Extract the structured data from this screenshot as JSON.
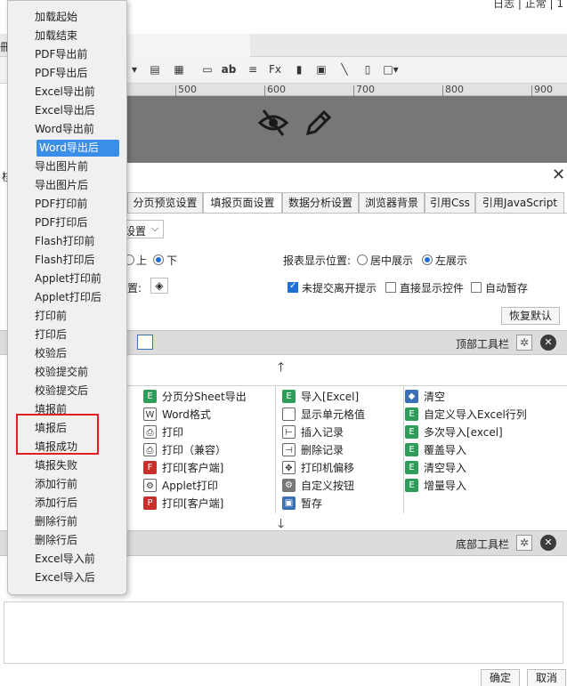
{
  "app": {
    "status_text": "日志 | 正常 | 1",
    "tab_partial": "冊"
  },
  "ruler": {
    "labels": [
      "500",
      "600",
      "700",
      "800",
      "900"
    ]
  },
  "dialog": {
    "tabs": [
      "分页预览设置",
      "填报页面设置",
      "数据分析设置",
      "浏览器背景",
      "引用Css",
      "引用JavaScript"
    ],
    "active_tab": "填报页面设置",
    "partial_tab_char": "核",
    "settings": {
      "dropdown_value": "设置",
      "position_label_partial": "置:",
      "radio_top": "上",
      "radio_bottom": "下",
      "display_position_label": "报表显示位置:",
      "center_display": "居中展示",
      "left_display": "左展示",
      "unsubmitted_prompt": "未提交离开提示",
      "direct_show_controls": "直接显示控件",
      "auto_save": "自动暂存",
      "restore_default": "恢复默认"
    },
    "top_toolbar_label": "顶部工具栏",
    "bottom_toolbar_label": "底部工具栏",
    "buttons": {
      "col1": [
        "分页分Sheet导出",
        "Word格式",
        "打印",
        "打印（兼容）",
        "打印[客户端]",
        "Applet打印",
        "打印[客户端]"
      ],
      "col2": [
        "导入[Excel]",
        "显示单元格值",
        "插入记录",
        "删除记录",
        "打印机偏移",
        "自定义按钮",
        "暂存"
      ],
      "col3": [
        "清空",
        "自定义导入Excel行列",
        "多次导入[excel]",
        "覆盖导入",
        "清空导入",
        "增量导入"
      ]
    },
    "ok": "确定",
    "cancel": "取消"
  },
  "menu": {
    "items": [
      "加载起始",
      "加载结束",
      "PDF导出前",
      "PDF导出后",
      "Excel导出前",
      "Excel导出后",
      "Word导出前",
      "Word导出后",
      "导出图片前",
      "导出图片后",
      "PDF打印前",
      "PDF打印后",
      "Flash打印前",
      "Flash打印后",
      "Applet打印前",
      "Applet打印后",
      "打印前",
      "打印后",
      "校验后",
      "校验提交前",
      "校验提交后",
      "填报前",
      "填报后",
      "填报成功",
      "填报失败",
      "添加行前",
      "添加行后",
      "删除行前",
      "删除行后",
      "Excel导入前",
      "Excel导入后"
    ],
    "selected": "Word导出后"
  },
  "colors": {
    "menu_selected": "#3b8ee8",
    "highlight_border": "#e02020",
    "checkbox_on": "#1e6fd9"
  }
}
